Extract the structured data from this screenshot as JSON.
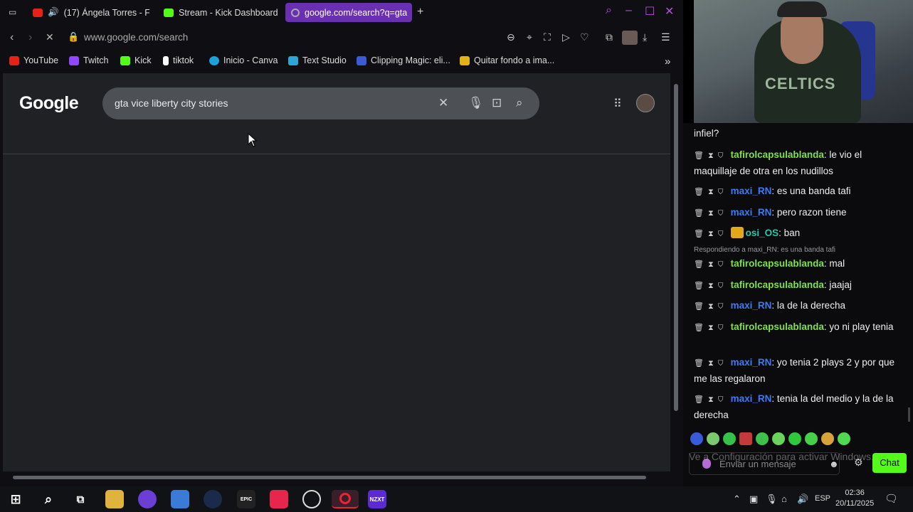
{
  "tabs": [
    {
      "label": "(17) Ángela Torres - F",
      "favicon_color": "#e62117",
      "active": false
    },
    {
      "label": "Stream - Kick Dashboard",
      "favicon_color": "#53fc18",
      "active": false
    },
    {
      "label": "google.com/search?q=gta",
      "favicon_color": "#777777",
      "active": true
    }
  ],
  "address": {
    "url": "www.google.com/search"
  },
  "bookmarks": [
    {
      "label": "YouTube",
      "color": "#e62117"
    },
    {
      "label": "Twitch",
      "color": "#9146ff"
    },
    {
      "label": "Kick",
      "color": "#53fc18"
    },
    {
      "label": "tiktok",
      "color": "#ffffff"
    },
    {
      "label": "Inicio - Canva",
      "color": "#1d9fd8"
    },
    {
      "label": "Text Studio",
      "color": "#2aa7d4"
    },
    {
      "label": "Clipping Magic: eli...",
      "color": "#3c5ad8"
    },
    {
      "label": "Quitar fondo a ima...",
      "color": "#e2b318"
    }
  ],
  "google": {
    "logo": "Google",
    "query": "gta vice liberty city stories"
  },
  "chat": {
    "top_fragment": "infiel?",
    "messages": [
      {
        "user": "tafirolcapsulablanda",
        "color": "green",
        "text": ": le vio el maquillaje de otra en los nudillos",
        "crown": false
      },
      {
        "user": "maxi_RN",
        "color": "blue",
        "text": ": es una banda tafi",
        "crown": false
      },
      {
        "user": "maxi_RN",
        "color": "blue",
        "text": ": pero razon tiene",
        "crown": false
      },
      {
        "user": "osi_OS",
        "color": "teal",
        "text": ": ban",
        "crown": true
      },
      {
        "user": "tafirolcapsulablanda",
        "color": "green",
        "text": ": mal",
        "crown": false
      },
      {
        "user": "tafirolcapsulablanda",
        "color": "green",
        "text": ": jaajaj",
        "crown": false
      },
      {
        "user": "maxi_RN",
        "color": "blue",
        "text": ": la de la derecha",
        "crown": false
      },
      {
        "user": "tafirolcapsulablanda",
        "color": "green",
        "text": ": yo ni play tenia",
        "crown": false
      },
      {
        "user": "maxi_RN",
        "color": "blue",
        "text": ": yo tenia 2 plays 2 y por que me las regalaron",
        "crown": false
      },
      {
        "user": "maxi_RN",
        "color": "blue",
        "text": ": tenia la del medio y la de la derecha",
        "crown": false
      }
    ],
    "reply_note": "Respondiendo a maxi_RN: es una banda tafi",
    "watermark": "Ve a Configuración para activar Windows.",
    "input_placeholder": "Enviar un mensaje",
    "send_label": "Chat",
    "webcam_shirt": "CELTICS"
  },
  "taskbar": {
    "lang": "ESP",
    "time": "02:36",
    "date": "20/11/2025",
    "nzxt_label": "NZXT",
    "epic_label": "EPIC"
  }
}
